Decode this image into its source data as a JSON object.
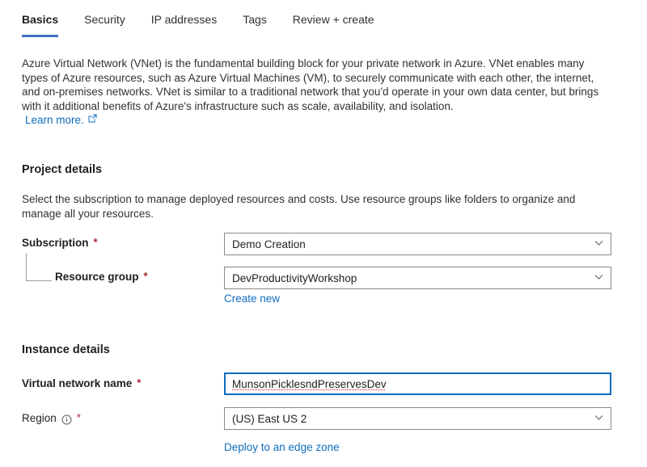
{
  "tabs": [
    {
      "label": "Basics",
      "active": true
    },
    {
      "label": "Security",
      "active": false
    },
    {
      "label": "IP addresses",
      "active": false
    },
    {
      "label": "Tags",
      "active": false
    },
    {
      "label": "Review + create",
      "active": false
    }
  ],
  "intro": {
    "text": "Azure Virtual Network (VNet) is the fundamental building block for your private network in Azure. VNet enables many types of Azure resources, such as Azure Virtual Machines (VM), to securely communicate with each other, the internet, and on-premises networks. VNet is similar to a traditional network that you'd operate in your own data center, but brings with it additional benefits of Azure's infrastructure such as scale, availability, and isolation.",
    "learn_more": "Learn more.",
    "learn_more_icon": "external-link-icon"
  },
  "project_details": {
    "title": "Project details",
    "description": "Select the subscription to manage deployed resources and costs. Use resource groups like folders to organize and manage all your resources.",
    "subscription": {
      "label": "Subscription",
      "required": "*",
      "value": "Demo Creation",
      "icon": "chevron-down-icon"
    },
    "resource_group": {
      "label": "Resource group",
      "required": "*",
      "value": "DevProductivityWorkshop",
      "icon": "chevron-down-icon",
      "create_new": "Create new"
    }
  },
  "instance_details": {
    "title": "Instance details",
    "virtual_network_name": {
      "label": "Virtual network name",
      "required": "*",
      "value": "MunsonPicklesndPreservesDev",
      "focused": true,
      "spellcheck_error": true
    },
    "region": {
      "label": "Region",
      "required": "*",
      "info_icon": "info-circle-icon",
      "value": "(US) East US 2",
      "icon": "chevron-down-icon",
      "edge_zone_link": "Deploy to an edge zone"
    }
  },
  "colors": {
    "accent": "#0f6cbd",
    "tab_underline": "#3f72bf",
    "required_asterisk": "#a4262c",
    "border": "#8a8886",
    "focus_border": "#0f6cbd",
    "spellcheck": "#e81123",
    "text": "#201f1e"
  }
}
